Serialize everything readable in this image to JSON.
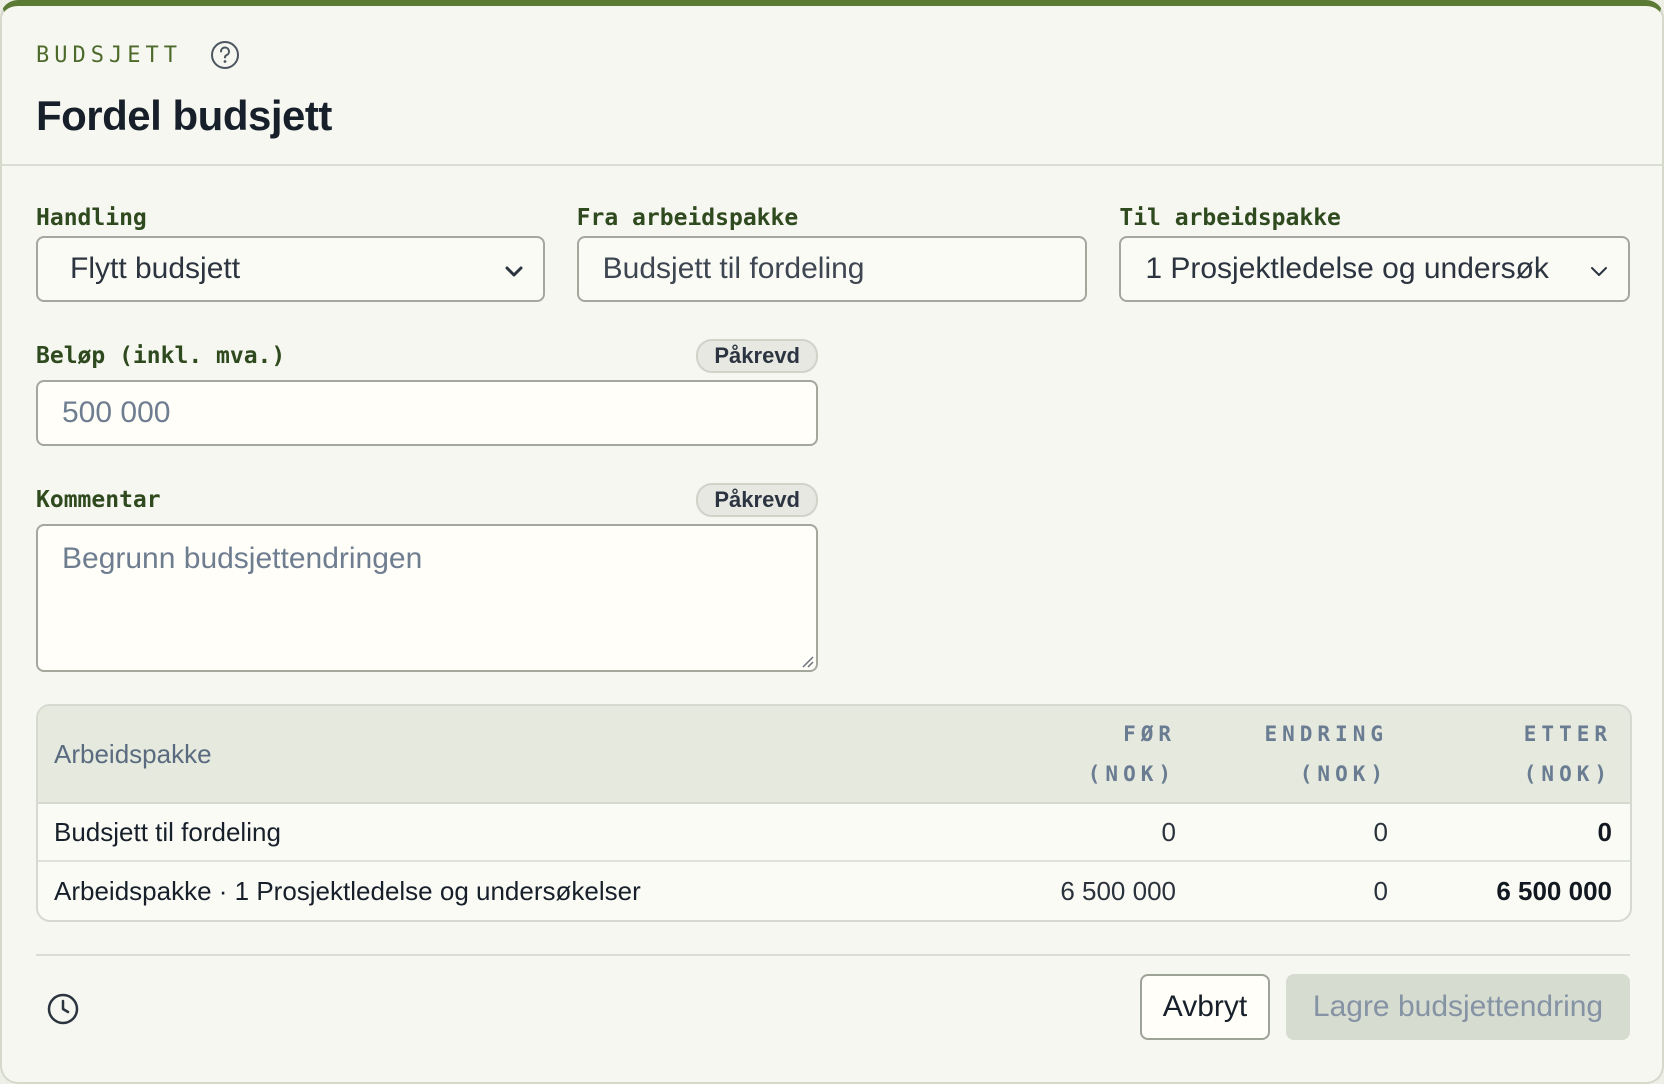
{
  "header": {
    "eyebrow": "BUDSJETT",
    "title": "Fordel budsjett"
  },
  "form": {
    "action": {
      "label": "Handling",
      "value": "Flytt budsjett"
    },
    "from": {
      "label": "Fra arbeidspakke",
      "value": "Budsjett til fordeling"
    },
    "to": {
      "label": "Til arbeidspakke",
      "value": "1 Prosjektledelse og undersøk"
    },
    "amount": {
      "label": "Beløp (inkl. mva.)",
      "badge": "Påkrevd",
      "placeholder": "500 000"
    },
    "comment": {
      "label": "Kommentar",
      "badge": "Påkrevd",
      "placeholder": "Begrunn budsjettendringen"
    }
  },
  "table": {
    "headers": {
      "name": "Arbeidspakke",
      "before_1": "FØR",
      "before_2": "(NOK)",
      "change_1": "ENDRING",
      "change_2": "(NOK)",
      "after_1": "ETTER",
      "after_2": "(NOK)"
    },
    "rows": [
      {
        "name": "Budsjett til fordeling",
        "before": "0",
        "change": "0",
        "after": "0"
      },
      {
        "name": "Arbeidspakke · 1 Prosjektledelse og undersøkelser",
        "before": "6 500 000",
        "change": "0",
        "after": "6 500 000"
      }
    ]
  },
  "footer": {
    "cancel_label": "Avbryt",
    "save_label": "Lagre budsjettendring"
  },
  "colors": {
    "accent": "#5b7a33",
    "label": "#2f4a1e",
    "disabled_button": "#d6dccf"
  }
}
